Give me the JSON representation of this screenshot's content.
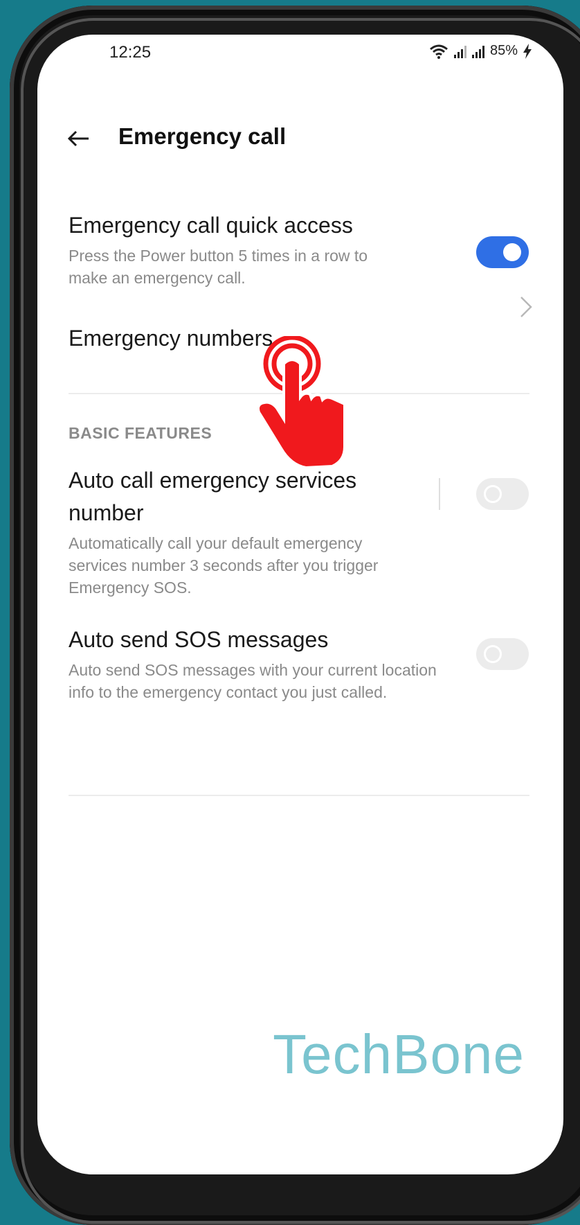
{
  "status_bar": {
    "time": "12:25",
    "battery": "85%"
  },
  "header": {
    "title": "Emergency call"
  },
  "settings": {
    "quick_access": {
      "title": "Emergency call quick access",
      "description": "Press the Power button 5 times in a row to make an emergency call.",
      "enabled": true
    },
    "emergency_numbers": {
      "title": "Emergency numbers"
    },
    "section_label": "BASIC FEATURES",
    "auto_call": {
      "title": "Auto call emergency services number",
      "description": "Automatically call your default emergency services number 3 seconds after you trigger Emergency SOS.",
      "enabled": false
    },
    "auto_sos": {
      "title": "Auto send SOS messages",
      "description": "Auto send SOS messages with your current location info to the emergency contact you just called.",
      "enabled": false
    }
  },
  "watermark": "TechBone",
  "colors": {
    "accent": "#2f6fe5",
    "hand": "#f0191d",
    "background": "#167b8a"
  }
}
